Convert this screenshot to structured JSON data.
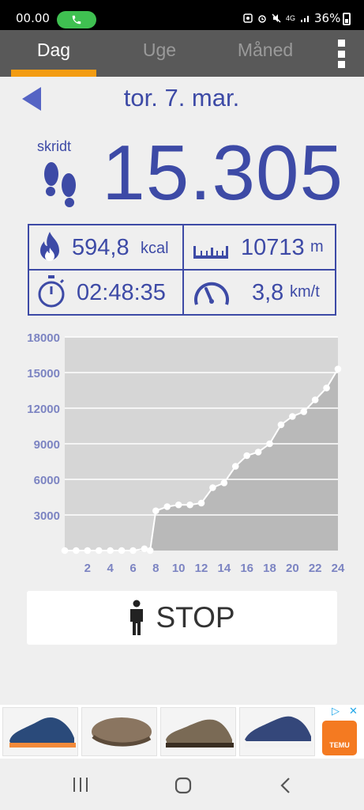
{
  "status_bar": {
    "time": "00.00",
    "battery": "36%",
    "network": "4G"
  },
  "tabs": [
    {
      "label": "Dag",
      "active": true
    },
    {
      "label": "Uge",
      "active": false
    },
    {
      "label": "Måned",
      "active": false
    }
  ],
  "date": "tor. 7. mar.",
  "steps": {
    "label": "skridt",
    "value": "15.305"
  },
  "stats": {
    "calories": {
      "value": "594,8",
      "unit": "kcal"
    },
    "distance": {
      "value": "10713",
      "unit": "m"
    },
    "duration": {
      "value": "02:48:35"
    },
    "speed": {
      "value": "3,8",
      "unit": "km/t"
    }
  },
  "chart_data": {
    "type": "line",
    "x": [
      0,
      1,
      2,
      3,
      4,
      5,
      6,
      7,
      7.5,
      8,
      9,
      10,
      11,
      12,
      13,
      14,
      15,
      16,
      17,
      18,
      19,
      20,
      21,
      22,
      23,
      24
    ],
    "y": [
      0,
      0,
      0,
      0,
      0,
      0,
      0,
      150,
      0,
      3350,
      3700,
      3850,
      3850,
      4000,
      5300,
      5700,
      7100,
      8000,
      8300,
      9000,
      10600,
      11300,
      11700,
      12700,
      13700,
      15300
    ],
    "xticks": [
      2,
      4,
      6,
      8,
      10,
      12,
      14,
      16,
      18,
      20,
      22,
      24
    ],
    "yticks": [
      3000,
      6000,
      9000,
      12000,
      15000,
      18000
    ],
    "ylim": [
      0,
      18000
    ],
    "xlim": [
      0,
      24
    ],
    "grid": true,
    "colors": {
      "plot_bg": "#d6d6d6",
      "fill": "#b9b9b9",
      "line": "#ffffff",
      "tick": "#7c84c2"
    }
  },
  "stop_button": {
    "label": "STOP"
  },
  "ad": {
    "brand": "TEMU"
  },
  "colors": {
    "accent": "#3d4aa6",
    "tab_underline": "#f39c12",
    "tab_bar": "#595959"
  }
}
